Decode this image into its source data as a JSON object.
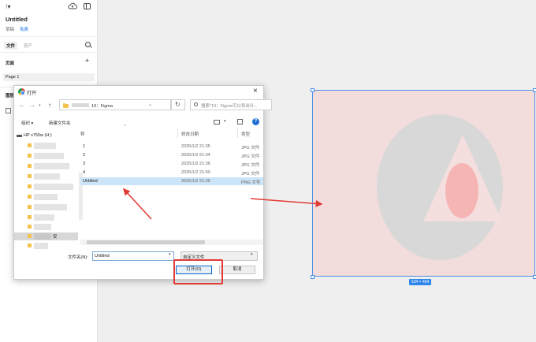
{
  "figma": {
    "file_title": "Untitled",
    "draft_label": "草稿",
    "plan_badge": "免费",
    "tabs": {
      "file": "文件",
      "assets": "资产"
    },
    "pages_heading": "页面",
    "pages": [
      "Page 1"
    ],
    "layers_heading": "图层"
  },
  "dialog": {
    "title": "打开",
    "address": {
      "segment": "19：Figma"
    },
    "search_placeholder": "搜索\"19：Figma可以导出什...",
    "toolbar": {
      "organize": "组织 ▾",
      "new_folder": "新建文件夹",
      "help": "?"
    },
    "nav": {
      "drive": "HP x750w (H:)",
      "selected_folder": "安"
    },
    "columns": {
      "name": "称",
      "date": "修改日期",
      "type": "类型"
    },
    "files": [
      {
        "name": "1",
        "date": "2025/1/2 21:35",
        "type": "JPG 文件"
      },
      {
        "name": "2",
        "date": "2025/1/2 21:34",
        "type": "JPG 文件"
      },
      {
        "name": "3",
        "date": "2025/1/2 21:36",
        "type": "JPG 文件"
      },
      {
        "name": "4",
        "date": "2025/1/2 21:50",
        "type": "JPG 文件"
      },
      {
        "name": "Untitled",
        "date": "2025/1/2 21:35",
        "type": "PNG 文件"
      }
    ],
    "filename_label": "文件名(N):",
    "filename_value": "Untitled",
    "filetype_value": "自定义文件",
    "open_label": "打开(O)",
    "cancel_label": "取消"
  },
  "canvas": {
    "dimensions_badge": "534 × 454",
    "colors": {
      "frame": "#f2dcdc",
      "selection": "#4a8fe3",
      "annotation": "#e23a35"
    }
  }
}
